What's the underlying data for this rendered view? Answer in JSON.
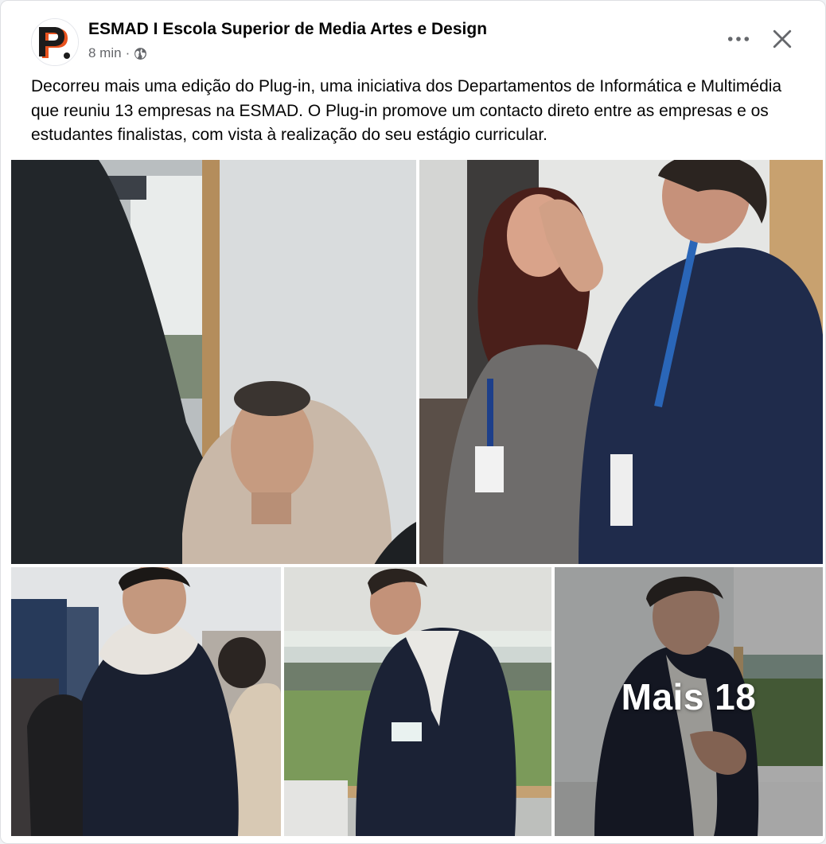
{
  "post": {
    "page_name": "ESMAD I Escola Superior de Media Artes e Design",
    "time": "8 min",
    "separator": "·",
    "visibility_icon": "globe-icon",
    "more_icon": "more-horizontal-icon",
    "close_icon": "close-icon",
    "avatar_icon": "plugin-logo-icon",
    "text": "Decorreu mais uma edição do Plug-in, uma iniciativa dos Departamentos de Informática e Multimédia que reuniu 13 empresas na ESMAD. O Plug-in promove um contacto direto entre as empresas e os estudantes finalistas, com vista à realização do seu estágio curricular."
  },
  "media": {
    "more_label": "Mais 18",
    "photos": [
      {
        "id": "photo-1"
      },
      {
        "id": "photo-2"
      },
      {
        "id": "photo-3"
      },
      {
        "id": "photo-4"
      },
      {
        "id": "photo-5"
      }
    ]
  },
  "colors": {
    "text_primary": "#050505",
    "text_secondary": "#65676b",
    "logo_orange": "#e8531f",
    "logo_dark": "#1c1c1c"
  }
}
